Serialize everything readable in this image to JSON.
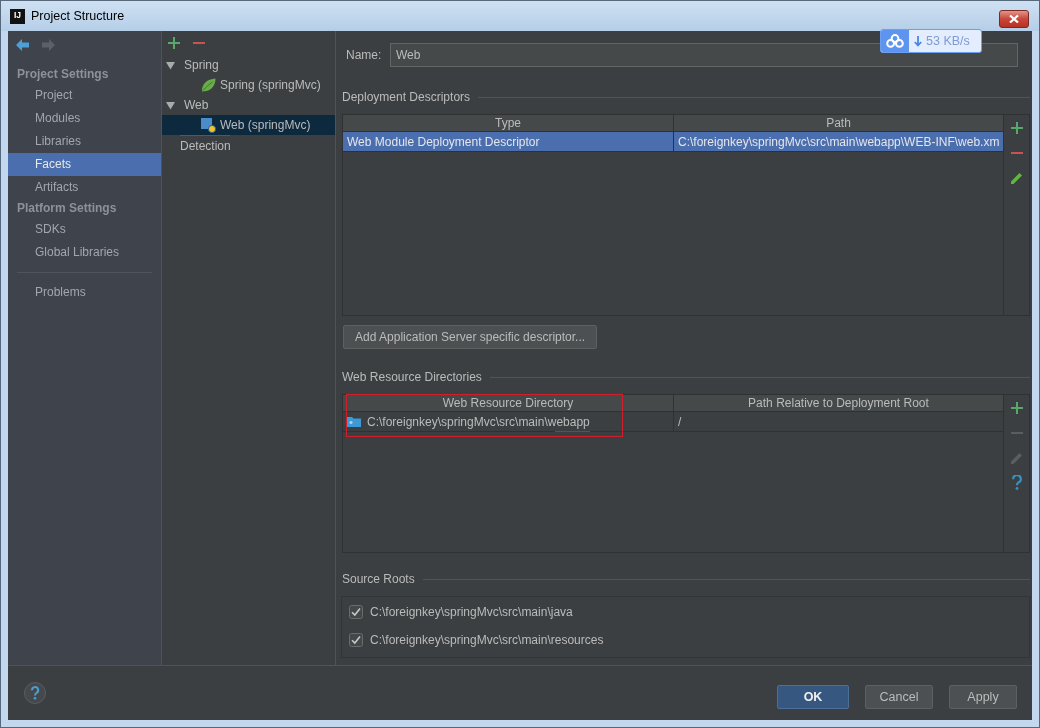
{
  "window": {
    "logo": "IJ",
    "title": "Project Structure"
  },
  "speed_indicator": {
    "reading": "53 KB/s"
  },
  "sidebar": {
    "nav": [
      {
        "kind": "back",
        "disabled": false
      },
      {
        "kind": "forward",
        "disabled": true
      }
    ],
    "sections": [
      {
        "heading": "Project Settings",
        "items": [
          {
            "label": "Project",
            "selected": false
          },
          {
            "label": "Modules",
            "selected": false
          },
          {
            "label": "Libraries",
            "selected": false
          },
          {
            "label": "Facets",
            "selected": true
          },
          {
            "label": "Artifacts",
            "selected": false
          }
        ]
      },
      {
        "heading": "Platform Settings",
        "items": [
          {
            "label": "SDKs",
            "selected": false
          },
          {
            "label": "Global Libraries",
            "selected": false
          }
        ]
      }
    ],
    "footer_items": [
      {
        "label": "Problems",
        "selected": false
      }
    ]
  },
  "facet_tree": {
    "toolbar": [
      {
        "kind": "add"
      },
      {
        "kind": "remove"
      }
    ],
    "groups": [
      {
        "label": "Spring",
        "expanded": true,
        "children": [
          {
            "label": "Spring (springMvc)",
            "kind": "spring",
            "selected": false
          }
        ]
      },
      {
        "label": "Web",
        "expanded": true,
        "children": [
          {
            "label": "Web (springMvc)",
            "kind": "web",
            "selected": true
          }
        ]
      }
    ],
    "footer": {
      "label": "Detection"
    }
  },
  "name_field": {
    "label": "Name:",
    "value": "Web"
  },
  "deployment_descriptors": {
    "title": "Deployment Descriptors",
    "columns": [
      "Type",
      "Path"
    ],
    "rows": [
      {
        "cells": [
          "Web Module Deployment Descriptor",
          "C:\\foreignkey\\springMvc\\src\\main\\webapp\\WEB-INF\\web.xm"
        ],
        "selected": true,
        "annotated": false
      }
    ],
    "actions": [
      {
        "kind": "add",
        "disabled": false
      },
      {
        "kind": "remove",
        "disabled": false
      },
      {
        "kind": "edit",
        "disabled": false
      }
    ],
    "add_button": "Add Application Server specific descriptor..."
  },
  "web_resource_directories": {
    "title": "Web Resource Directories",
    "columns": [
      "Web Resource Directory",
      "Path Relative to Deployment Root"
    ],
    "rows": [
      {
        "cells": [
          "C:\\foreignkey\\springMvc\\src\\main\\webapp",
          "/"
        ],
        "selected": false,
        "annotated": true
      }
    ],
    "actions": [
      {
        "kind": "add",
        "disabled": false
      },
      {
        "kind": "remove",
        "disabled": true
      },
      {
        "kind": "edit",
        "disabled": true
      },
      {
        "kind": "help",
        "disabled": false
      }
    ]
  },
  "source_roots": {
    "title": "Source Roots",
    "items": [
      {
        "label": "C:\\foreignkey\\springMvc\\src\\main\\java",
        "checked": true
      },
      {
        "label": "C:\\foreignkey\\springMvc\\src\\main\\resources",
        "checked": true
      }
    ]
  },
  "buttons": [
    {
      "label": "OK",
      "kind": "default"
    },
    {
      "label": "Cancel",
      "kind": "normal"
    },
    {
      "label": "Apply",
      "kind": "normal"
    }
  ]
}
